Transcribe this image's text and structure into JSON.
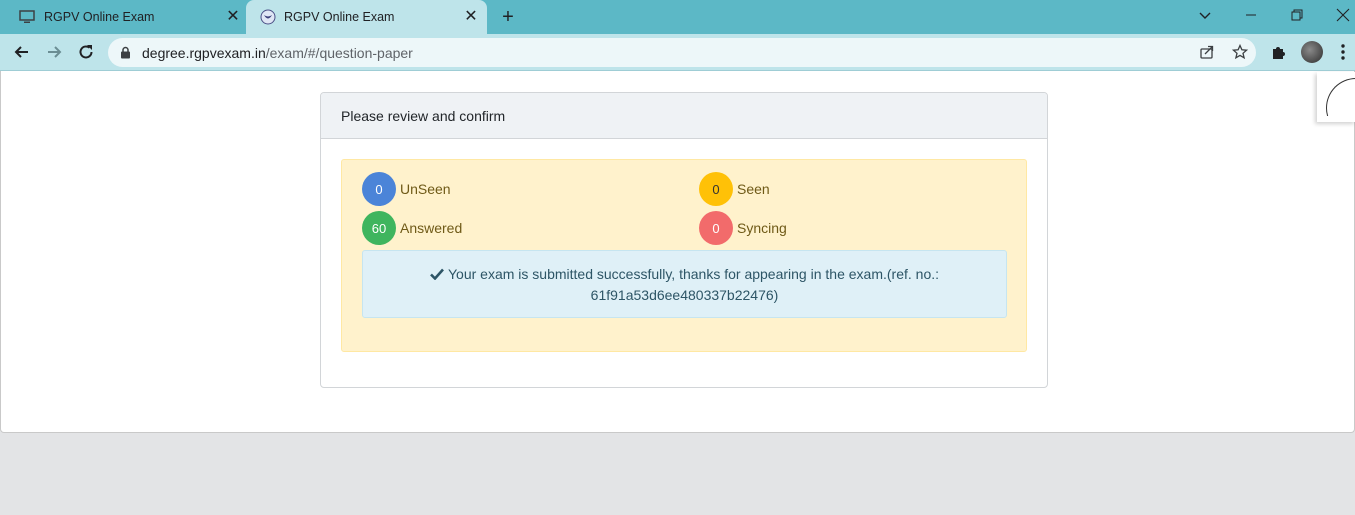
{
  "browser": {
    "tabs": [
      {
        "title": "RGPV Online Exam",
        "active": false
      },
      {
        "title": "RGPV Online Exam",
        "active": true
      }
    ],
    "address": {
      "host": "degree.rgpvexam.in",
      "path": "/exam/#/question-paper"
    }
  },
  "exam": {
    "header": "Please review and confirm",
    "stats": {
      "unseen": {
        "count": "0",
        "label": "UnSeen"
      },
      "seen": {
        "count": "0",
        "label": "Seen"
      },
      "answered": {
        "count": "60",
        "label": "Answered"
      },
      "syncing": {
        "count": "0",
        "label": "Syncing"
      }
    },
    "message_line1": "Your exam is submitted successfully, thanks for appearing in the exam.(ref. no.:",
    "message_line2": "61f91a53d6ee480337b22476)"
  },
  "colors": {
    "tabstrip": "#5cb8c6",
    "unseen": "#4b84d8",
    "seen": "#ffc107",
    "answered": "#3fb55e",
    "syncing": "#f26b6b"
  }
}
